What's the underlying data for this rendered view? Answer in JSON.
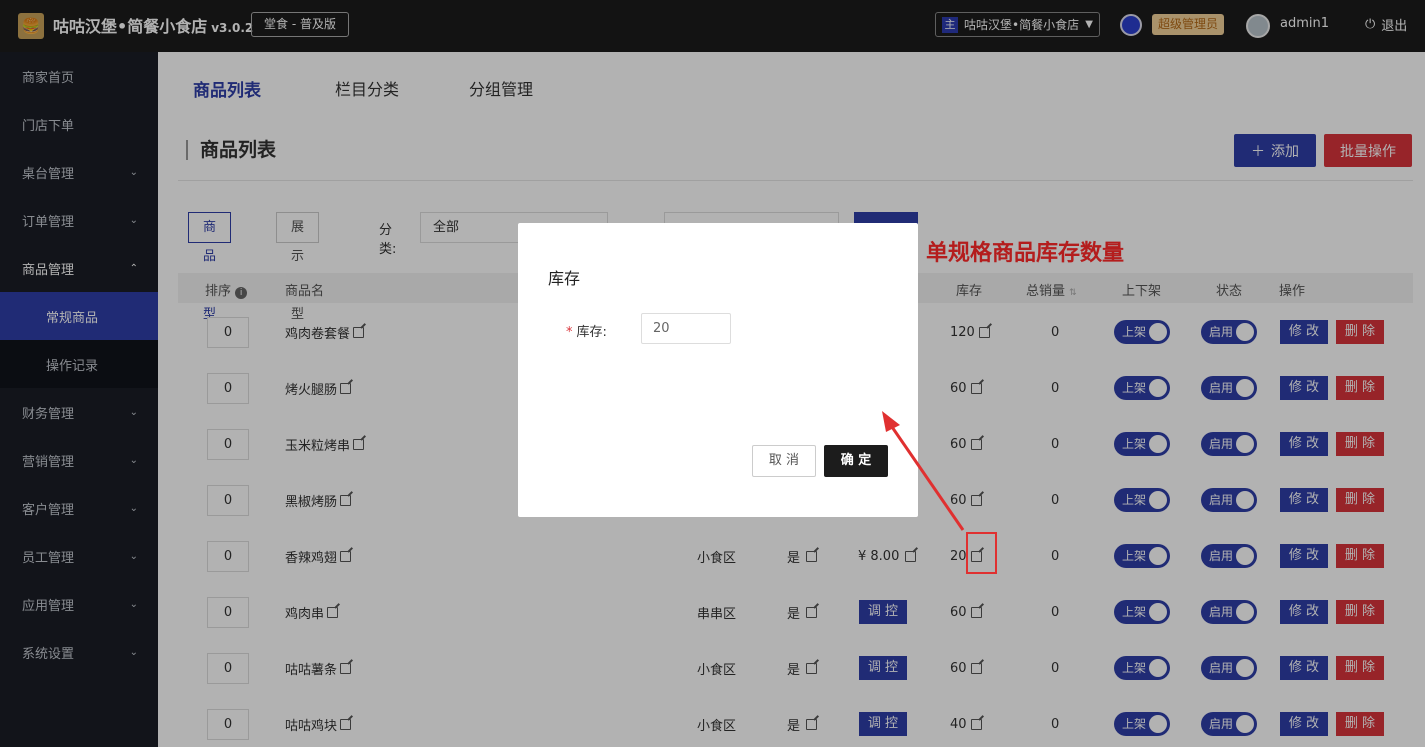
{
  "header": {
    "shop_name": "咕咕汉堡•简餐小食店",
    "version": "v3.0.2",
    "edition": "堂食 - 普及版",
    "store_tag": "主",
    "store_select": "咕咕汉堡•简餐小食店",
    "role": "超级管理员",
    "username": "admin1",
    "logout": "退出"
  },
  "sidebar": {
    "items": [
      {
        "label": "商家首页"
      },
      {
        "label": "门店下单"
      },
      {
        "label": "桌台管理"
      },
      {
        "label": "订单管理"
      },
      {
        "label": "商品管理"
      },
      {
        "label": "常规商品"
      },
      {
        "label": "操作记录"
      },
      {
        "label": "财务管理"
      },
      {
        "label": "营销管理"
      },
      {
        "label": "客户管理"
      },
      {
        "label": "员工管理"
      },
      {
        "label": "应用管理"
      },
      {
        "label": "系统设置"
      }
    ]
  },
  "tabs": [
    {
      "label": "商品列表"
    },
    {
      "label": "栏目分类"
    },
    {
      "label": "分组管理"
    }
  ],
  "page": {
    "title": "商品列表",
    "add_label": "添加",
    "batch_label": "批量操作"
  },
  "filters": {
    "seg1": "商品类型",
    "seg2": "展示类型",
    "category_label": "分类:",
    "category_value": "全部"
  },
  "annotation": "单规格商品库存数量",
  "table": {
    "headers": [
      "排序",
      "商品名",
      "库存",
      "总销量",
      "上下架",
      "状态",
      "操作"
    ],
    "rows": [
      {
        "sort": "0",
        "name": "鸡肉卷套餐",
        "zone": "",
        "flag": "",
        "price": "",
        "stock": "120",
        "sales": "0"
      },
      {
        "sort": "0",
        "name": "烤火腿肠",
        "zone": "",
        "flag": "",
        "price": "",
        "stock": "60",
        "sales": "0"
      },
      {
        "sort": "0",
        "name": "玉米粒烤串",
        "zone": "",
        "flag": "",
        "price": "",
        "stock": "60",
        "sales": "0"
      },
      {
        "sort": "0",
        "name": "黑椒烤肠",
        "zone": "",
        "flag": "",
        "price": "",
        "stock": "60",
        "sales": "0"
      },
      {
        "sort": "0",
        "name": "香辣鸡翅",
        "zone": "小食区",
        "flag": "是",
        "price": "¥ 8.00",
        "stock": "20",
        "sales": "0"
      },
      {
        "sort": "0",
        "name": "鸡肉串",
        "zone": "串串区",
        "flag": "是",
        "price": "调 控",
        "stock": "60",
        "sales": "0"
      },
      {
        "sort": "0",
        "name": "咕咕薯条",
        "zone": "小食区",
        "flag": "是",
        "price": "调 控",
        "stock": "60",
        "sales": "0"
      },
      {
        "sort": "0",
        "name": "咕咕鸡块",
        "zone": "小食区",
        "flag": "是",
        "price": "调 控",
        "stock": "40",
        "sales": "0"
      }
    ],
    "shelf_label": "上架",
    "status_label": "启用",
    "edit_label": "修 改",
    "delete_label": "删 除"
  },
  "dialog": {
    "title": "库存",
    "field_label": "库存:",
    "required_mark": "*",
    "value": "20",
    "cancel": "取 消",
    "ok": "确 定"
  }
}
